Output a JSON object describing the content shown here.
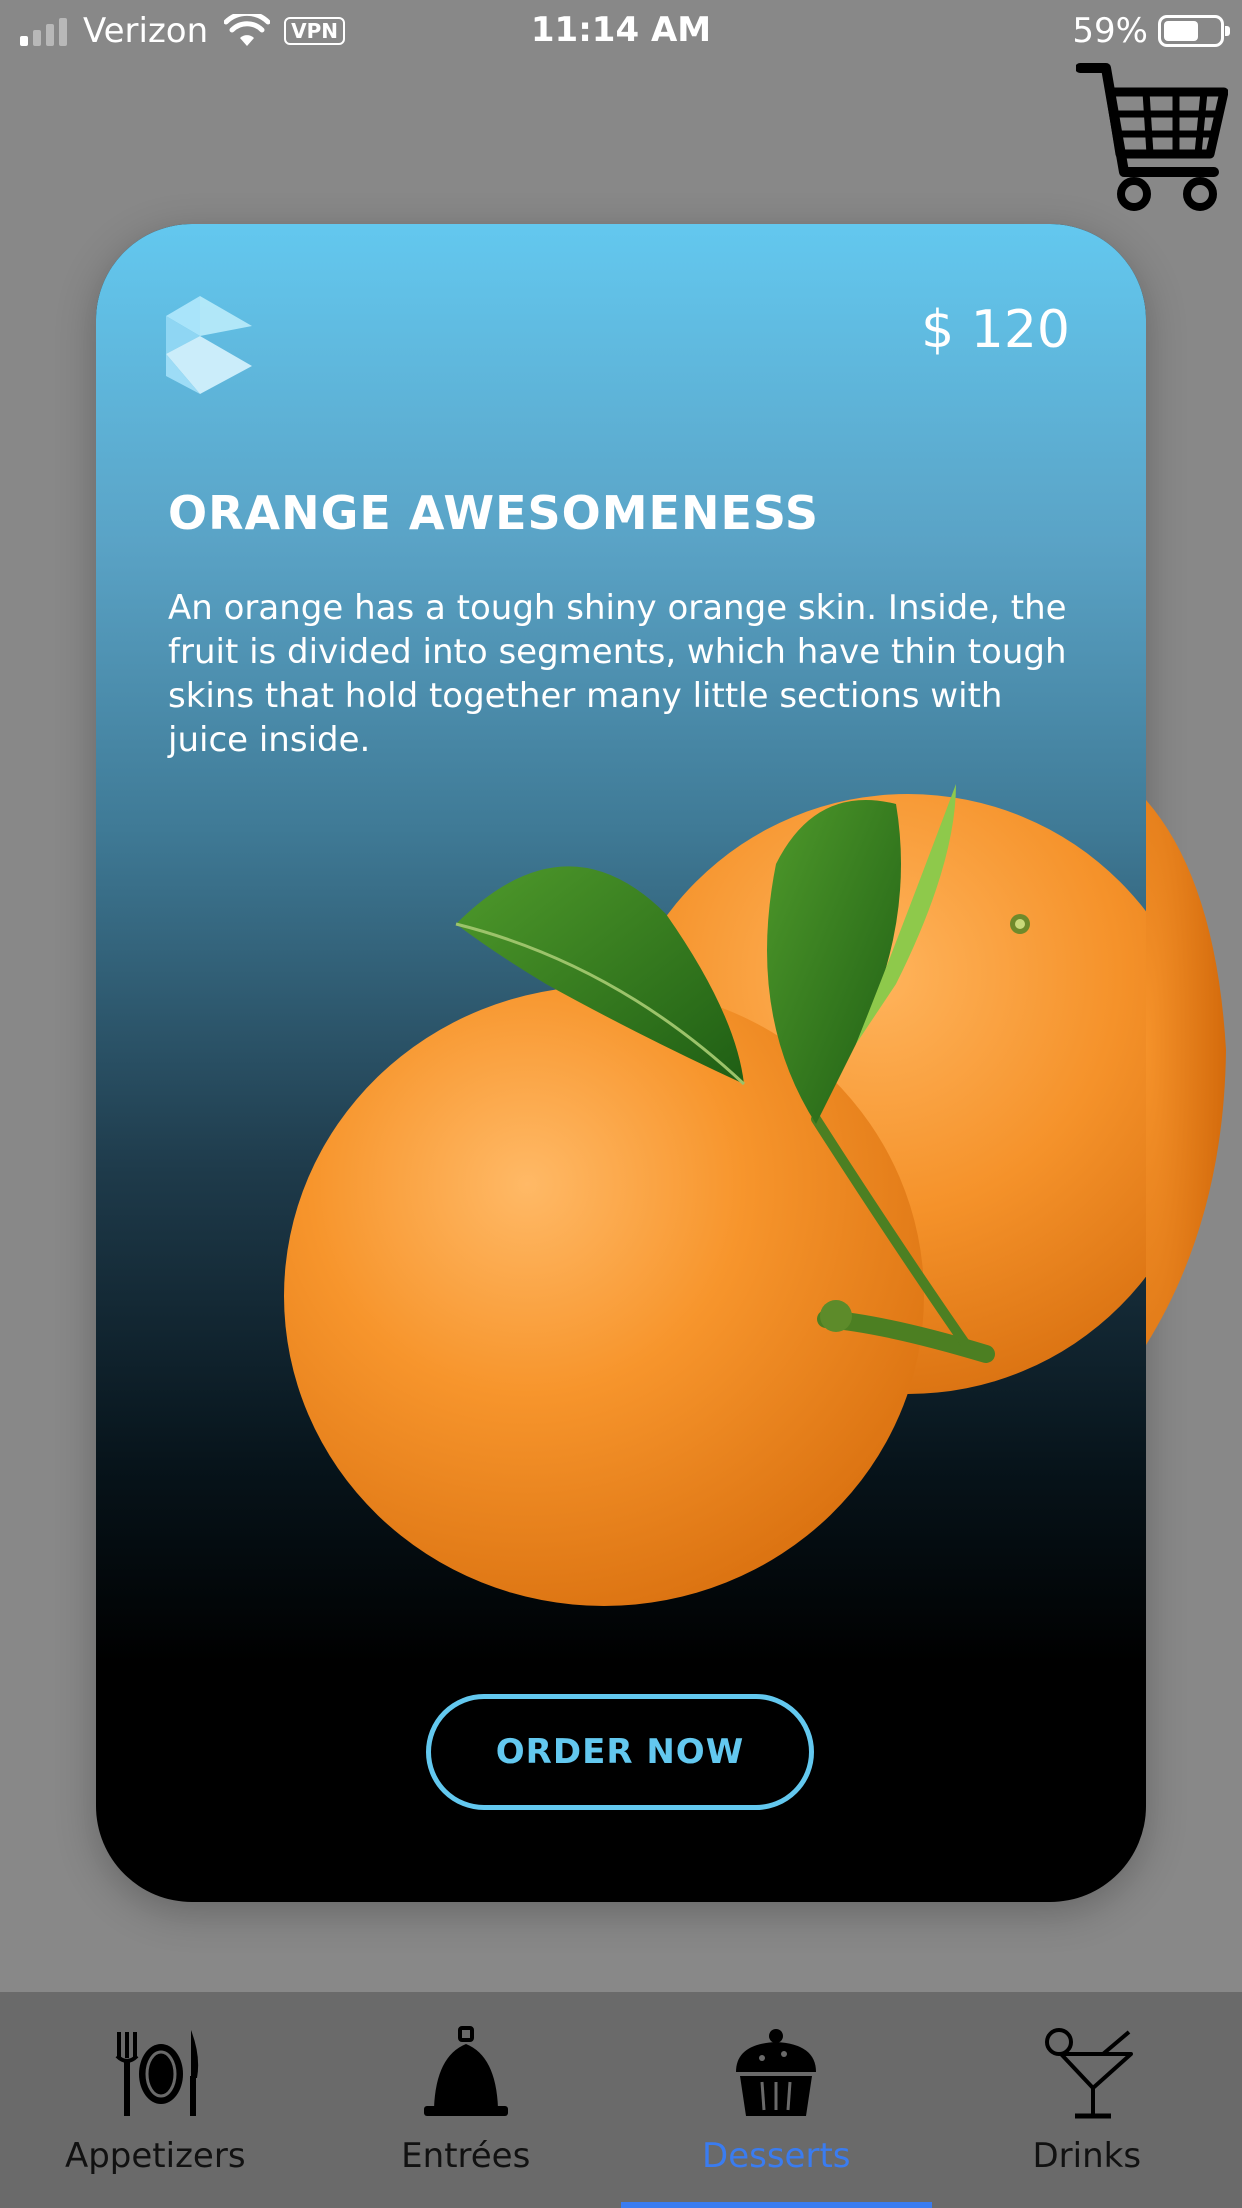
{
  "status_bar": {
    "carrier": "Verizon",
    "vpn_label": "VPN",
    "time": "11:14 AM",
    "battery_percent": "59%",
    "battery_level": 0.59,
    "signal_bars_active": 1,
    "signal_bars_total": 4
  },
  "header": {
    "cart_icon": "shopping-cart-icon"
  },
  "product": {
    "price": "$ 120",
    "title": "ORANGE AWESOMENESS",
    "description": "An orange has a tough shiny orange skin. Inside, the fruit is divided into segments, which have thin tough skins that hold together many little sections with juice inside.",
    "image": "two-oranges-with-leaves",
    "order_button_label": "ORDER NOW",
    "colors": {
      "accent": "#63c8ef",
      "gradient_top": "#63c8ef",
      "gradient_bottom": "#000000"
    }
  },
  "tabs": {
    "items": [
      {
        "label": "Appetizers",
        "icon": "plate-cutlery-icon"
      },
      {
        "label": "Entrées",
        "icon": "cloche-icon"
      },
      {
        "label": "Desserts",
        "icon": "cupcake-icon"
      },
      {
        "label": "Drinks",
        "icon": "cocktail-icon"
      }
    ],
    "active_label": "Desserts",
    "active_color": "#3a7cf0"
  }
}
